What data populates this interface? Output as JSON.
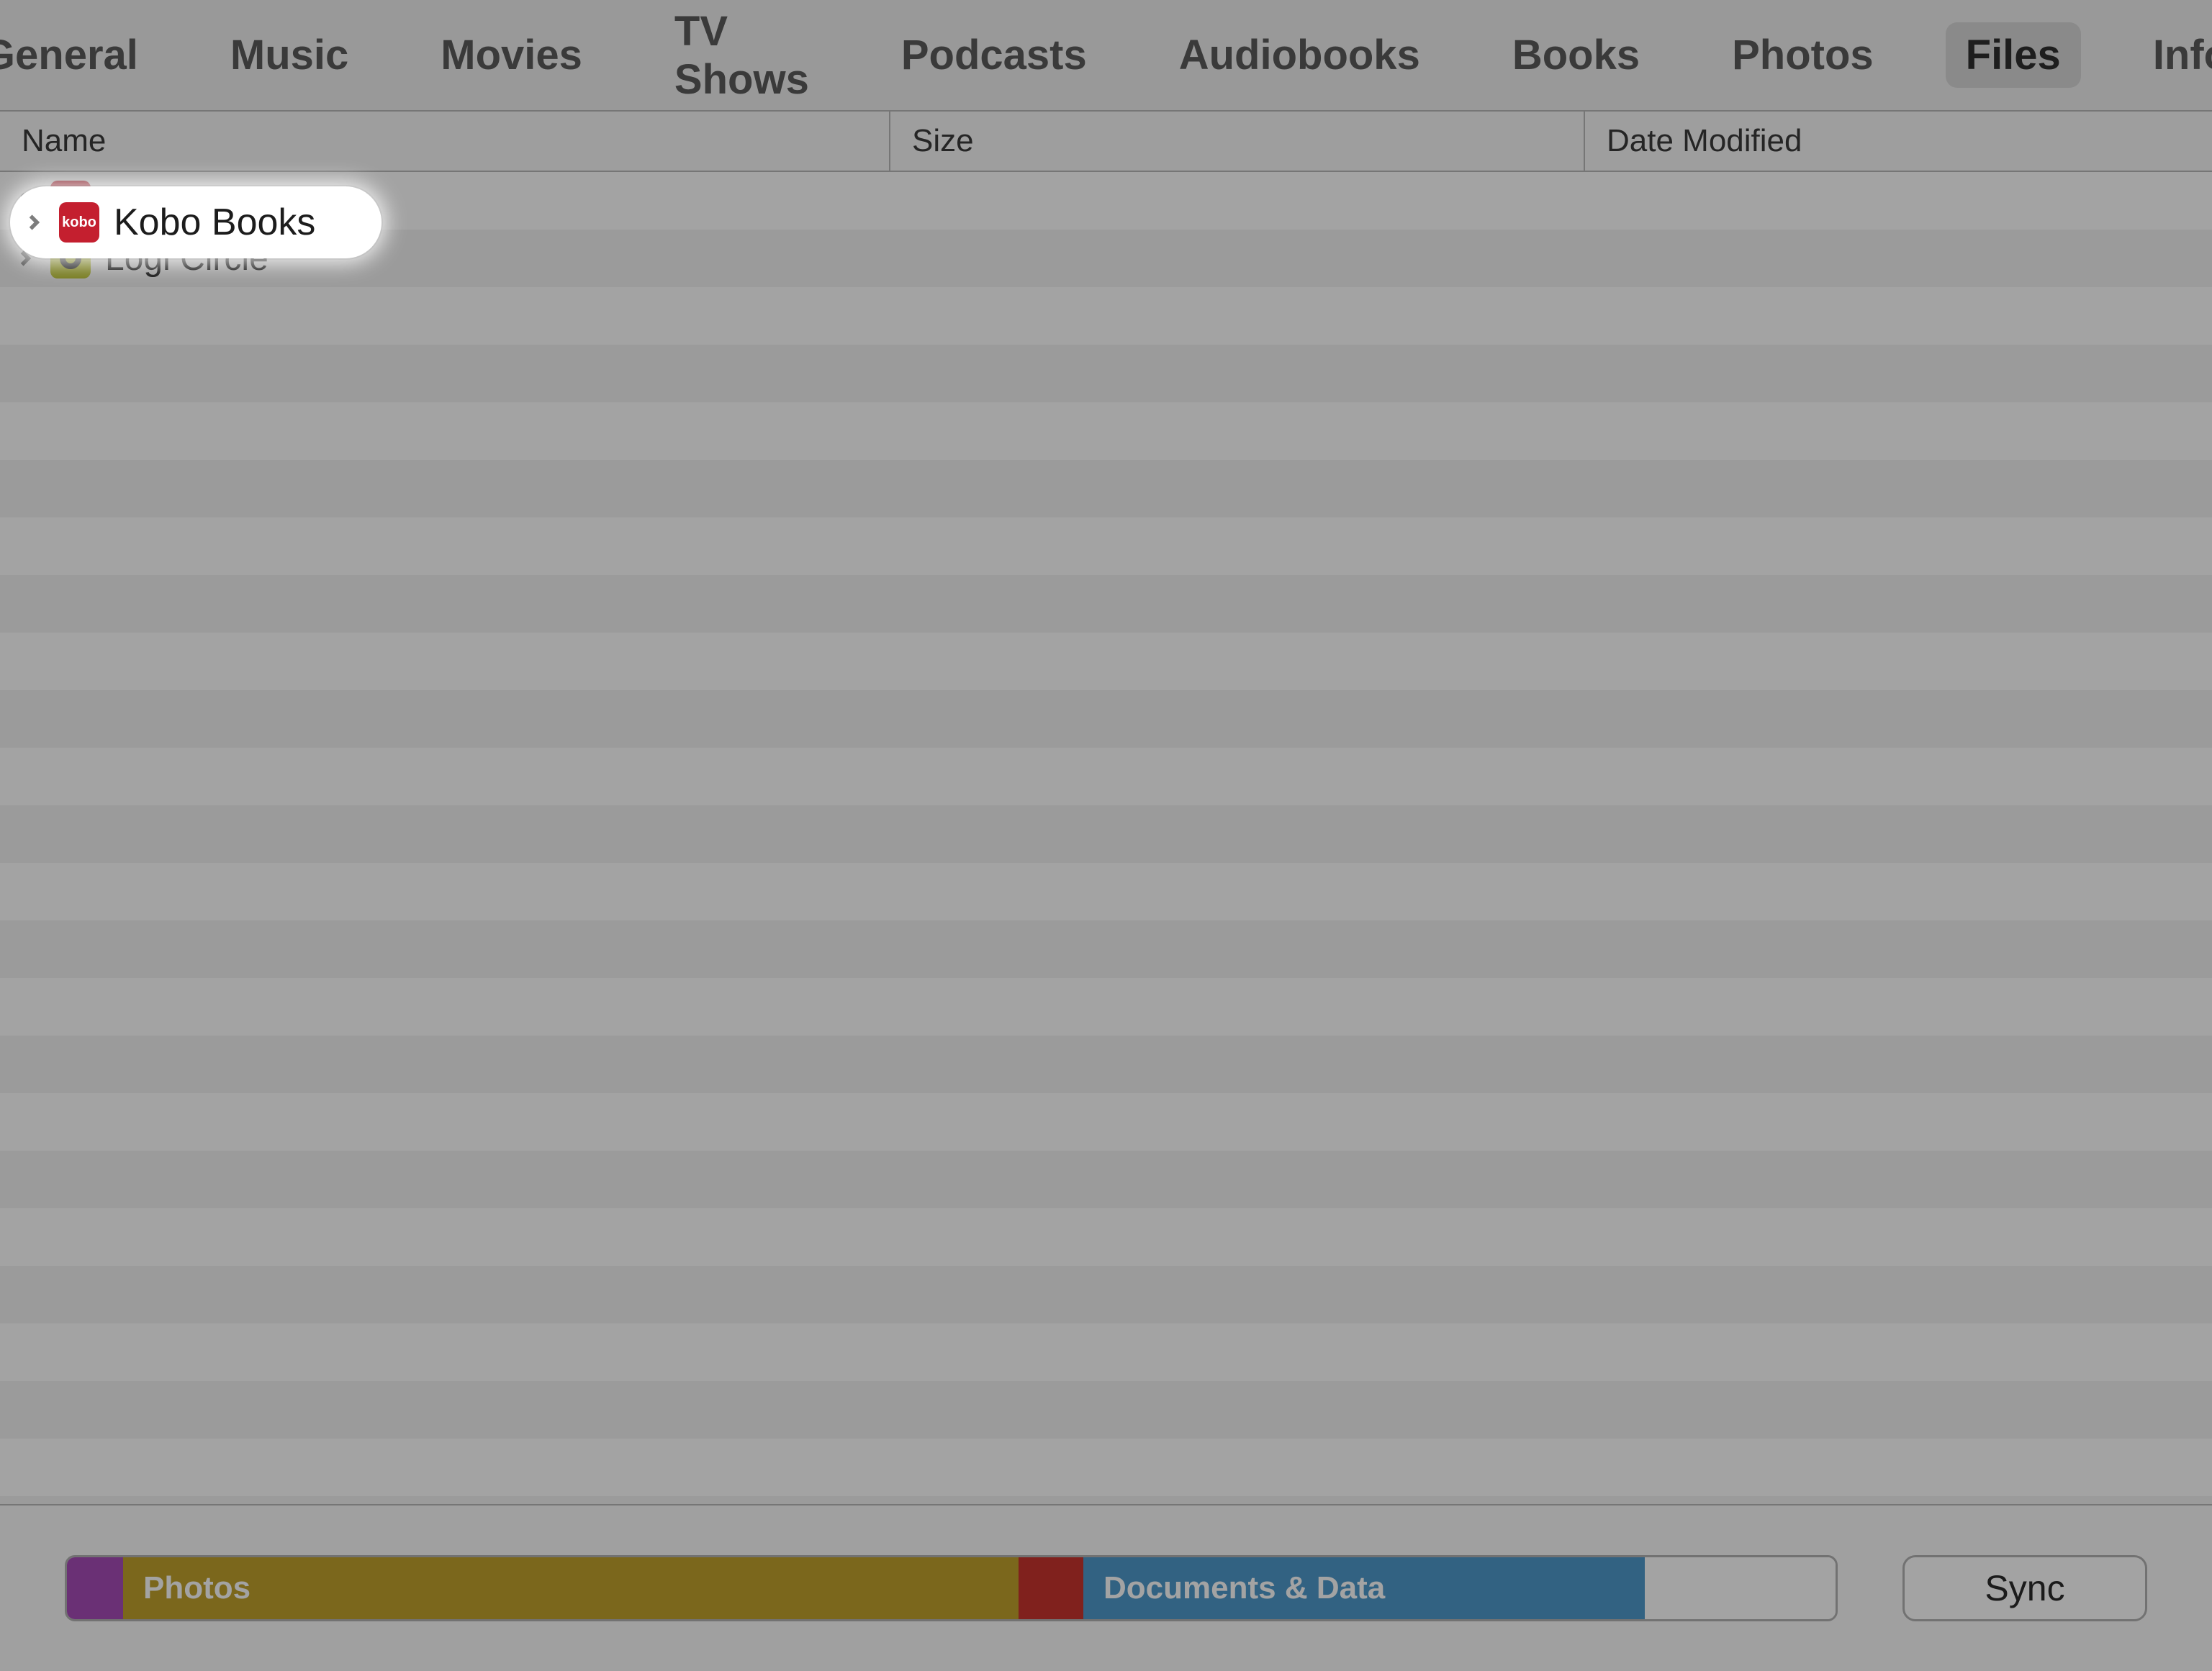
{
  "tabs": {
    "items": [
      {
        "id": "general",
        "label": "General"
      },
      {
        "id": "music",
        "label": "Music"
      },
      {
        "id": "movies",
        "label": "Movies"
      },
      {
        "id": "tvshows",
        "label": "TV Shows"
      },
      {
        "id": "podcasts",
        "label": "Podcasts"
      },
      {
        "id": "audiobooks",
        "label": "Audiobooks"
      },
      {
        "id": "books",
        "label": "Books"
      },
      {
        "id": "photos",
        "label": "Photos"
      },
      {
        "id": "files",
        "label": "Files"
      },
      {
        "id": "info",
        "label": "Info"
      }
    ],
    "active": "files"
  },
  "columns": {
    "name": "Name",
    "size": "Size",
    "date_modified": "Date Modified"
  },
  "files": [
    {
      "name": "Kobo Books",
      "icon": "kobo-icon",
      "highlighted": true
    },
    {
      "name": "Logi Circle",
      "icon": "logi-icon",
      "highlighted": false
    }
  ],
  "storage": {
    "segments": [
      {
        "id": "other",
        "label": "",
        "color": "#a64cb7"
      },
      {
        "id": "photos",
        "label": "Photos",
        "color": "#c0a22d"
      },
      {
        "id": "apps",
        "label": "",
        "color": "#c9352e"
      },
      {
        "id": "docs",
        "label": "Documents & Data",
        "color": "#4f9acb"
      },
      {
        "id": "free",
        "label": "",
        "color": "#ffffff"
      }
    ]
  },
  "footer": {
    "sync_label": "Sync"
  }
}
